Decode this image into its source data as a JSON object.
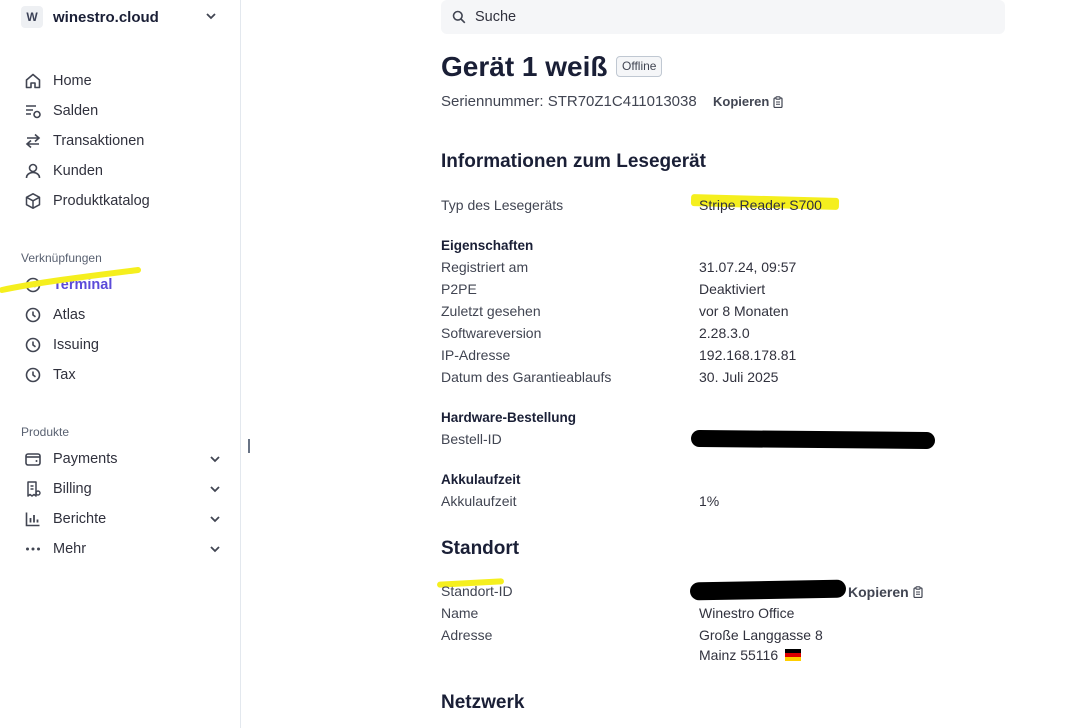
{
  "account": {
    "initial": "W",
    "name": "winestro.cloud"
  },
  "nav": {
    "main": [
      {
        "label": "Home",
        "icon": "home-icon"
      },
      {
        "label": "Salden",
        "icon": "balances-icon"
      },
      {
        "label": "Transaktionen",
        "icon": "arrows-icon"
      },
      {
        "label": "Kunden",
        "icon": "person-icon"
      },
      {
        "label": "Produktkatalog",
        "icon": "box-icon"
      }
    ],
    "shortcuts_label": "Verknüpfungen",
    "shortcuts": [
      {
        "label": "Terminal",
        "icon": "clock-icon",
        "active": true
      },
      {
        "label": "Atlas",
        "icon": "clock-icon"
      },
      {
        "label": "Issuing",
        "icon": "clock-icon"
      },
      {
        "label": "Tax",
        "icon": "clock-icon"
      }
    ],
    "products_label": "Produkte",
    "products": [
      {
        "label": "Payments",
        "icon": "wallet-icon"
      },
      {
        "label": "Billing",
        "icon": "receipt-icon"
      },
      {
        "label": "Berichte",
        "icon": "bar-chart-icon"
      },
      {
        "label": "Mehr",
        "icon": "more-icon"
      }
    ]
  },
  "search": {
    "placeholder": "Suche"
  },
  "device": {
    "title": "Gerät 1 weiß",
    "status": "Offline",
    "serial": "Seriennummer: STR70Z1C411013038",
    "copy_label": "Kopieren"
  },
  "reader_info": {
    "heading": "Informationen zum Lesegerät",
    "type_label": "Typ des Lesegeräts",
    "type_value": "Stripe Reader S700",
    "properties_heading": "Eigenschaften",
    "properties": [
      {
        "label": "Registriert am",
        "value": "31.07.24, 09:57"
      },
      {
        "label": "P2PE",
        "value": "Deaktiviert"
      },
      {
        "label": "Zuletzt gesehen",
        "value": "vor 8 Monaten"
      },
      {
        "label": "Softwareversion",
        "value": "2.28.3.0"
      },
      {
        "label": "IP-Adresse",
        "value": "192.168.178.81"
      },
      {
        "label": "Datum des Garantieablaufs",
        "value": "30. Juli 2025"
      }
    ],
    "hardware_heading": "Hardware-Bestellung",
    "order_id_label": "Bestell-ID",
    "battery_heading": "Akkulaufzeit",
    "battery_label": "Akkulaufzeit",
    "battery_value": "1%"
  },
  "location": {
    "heading": "Standort",
    "id_label": "Standort-ID",
    "copy_label": "Kopieren",
    "name_label": "Name",
    "name_value": "Winestro Office",
    "address_label": "Adresse",
    "address_line1": "Große Langgasse 8",
    "address_line2": "Mainz 55116"
  },
  "network": {
    "heading": "Netzwerk"
  },
  "colors": {
    "accent": "#5b4bd9",
    "highlight": "#f5ef1e",
    "text": "#30313d",
    "muted": "#414552"
  }
}
